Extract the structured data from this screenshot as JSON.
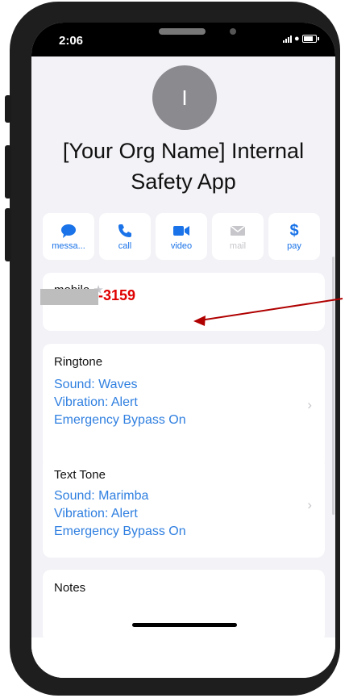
{
  "status": {
    "time": "2:06"
  },
  "contact": {
    "initial": "I",
    "name_line1": "[Your Org Name] Internal",
    "name_line2": "Safety App"
  },
  "actions": [
    {
      "label": "messa...",
      "icon": "message-icon",
      "enabled": true
    },
    {
      "label": "call",
      "icon": "phone-icon",
      "enabled": true
    },
    {
      "label": "video",
      "icon": "video-icon",
      "enabled": true
    },
    {
      "label": "mail",
      "icon": "mail-icon",
      "enabled": false
    },
    {
      "label": "pay",
      "icon": "dollar-icon",
      "enabled": true
    }
  ],
  "mobile": {
    "label": "mobile",
    "number_suffix": "-3159"
  },
  "ringtone": {
    "label": "Ringtone",
    "sound": "Sound: Waves",
    "vibration": "Vibration: Alert",
    "bypass": "Emergency Bypass On"
  },
  "texttone": {
    "label": "Text Tone",
    "sound": "Sound: Marimba",
    "vibration": "Vibration: Alert",
    "bypass": "Emergency Bypass On"
  },
  "notes": {
    "label": "Notes"
  },
  "colors": {
    "accent": "#2f7fe0",
    "highlight": "#e00000",
    "background": "#f2f2f7"
  }
}
